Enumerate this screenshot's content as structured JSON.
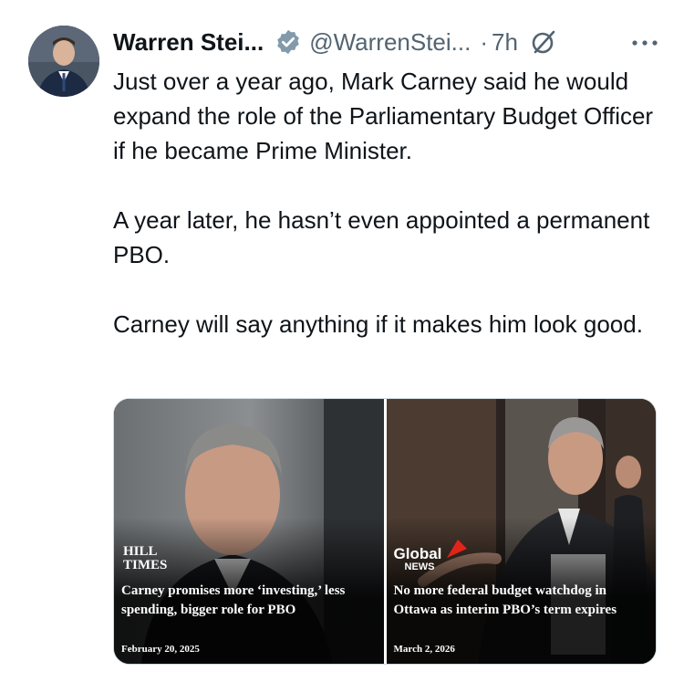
{
  "tweet": {
    "author_name": "Warren Stei...",
    "handle": "@WarrenStei...",
    "separator": "·",
    "time": "7h",
    "paragraphs": [
      "Just over a year ago, Mark Carney said he would expand the role of the Parliamentary Budget Officer if he became Prime Minister.",
      "A year later, he hasn’t even appointed a permanent PBO.",
      "Carney will say anything if it makes him look good."
    ]
  },
  "media": {
    "left": {
      "logo_line1": "HILL",
      "logo_line2": "TIMES",
      "headline": "Carney promises more ‘investing,’ less spending, bigger role for PBO",
      "date": "February 20, 2025"
    },
    "right": {
      "logo_main": "Global",
      "logo_sub": "NEWS",
      "headline": "No more federal budget watchdog in Ottawa as interim PBO’s term expires",
      "date": "March 2, 2026"
    }
  },
  "colors": {
    "verified": "#829aab",
    "secondary_text": "#536471",
    "global_red": "#e2231a"
  },
  "icons": {
    "verified": "verified-badge-icon",
    "grok": "grok-icon",
    "more": "more-icon"
  }
}
